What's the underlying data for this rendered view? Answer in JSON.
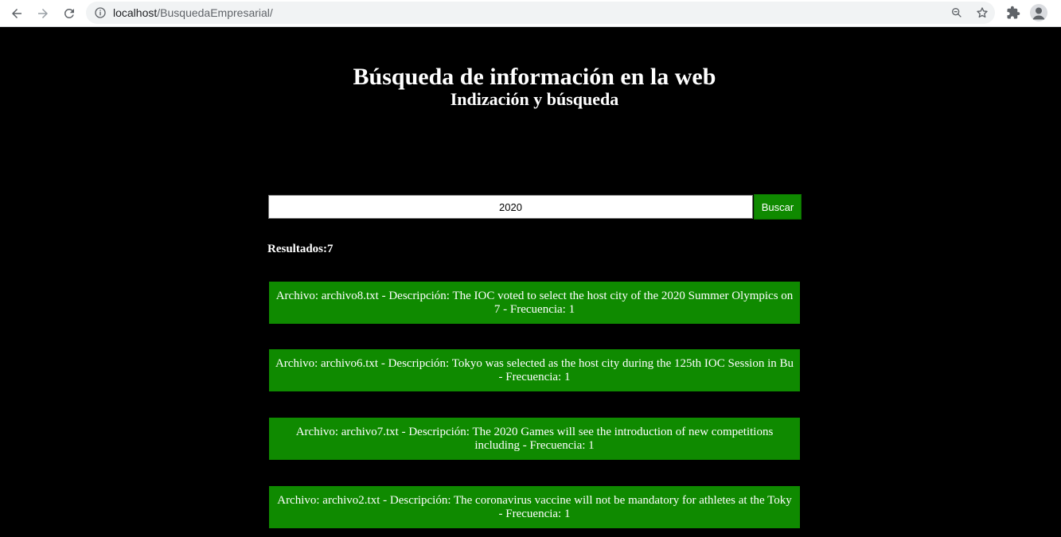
{
  "browser": {
    "url_host": "localhost",
    "url_path": "/BusquedaEmpresarial/"
  },
  "header": {
    "title": "Búsqueda de información en la web",
    "subtitle": "Indización y búsqueda"
  },
  "search": {
    "value": "2020",
    "button_label": "Buscar"
  },
  "results": {
    "label": "Resultados:7",
    "items": [
      {
        "text": "Archivo: archivo8.txt - Descripción: The IOC voted to select the host city of the 2020 Summer Olympics on 7 - Frecuencia: 1"
      },
      {
        "text": "Archivo: archivo6.txt - Descripción: Tokyo was selected as the host city during the 125th IOC Session in Bu - Frecuencia: 1"
      },
      {
        "text": "Archivo: archivo7.txt - Descripción: The 2020 Games will see the introduction of new competitions including - Frecuencia: 1"
      },
      {
        "text": "Archivo: archivo2.txt - Descripción: The coronavirus vaccine will not be mandatory for athletes at the Toky - Frecuencia: 1"
      }
    ]
  },
  "colors": {
    "background": "#000000",
    "accent_green": "#0f8a00",
    "text": "#ffffff"
  }
}
